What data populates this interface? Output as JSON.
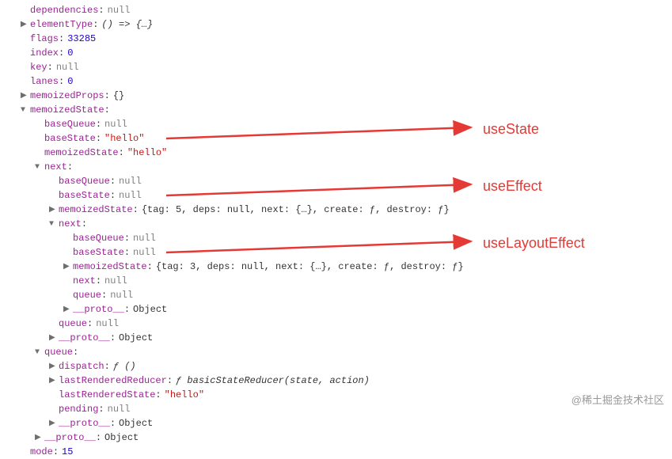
{
  "lines": {
    "dependencies": "dependencies",
    "elementType": "elementType",
    "flags": "flags",
    "index": "index",
    "keyProp": "key",
    "lanes": "lanes",
    "memoizedProps": "memoizedProps",
    "memoizedState": "memoizedState",
    "baseQueue": "baseQueue",
    "baseState": "baseState",
    "next": "next",
    "queue": "queue",
    "proto": "__proto__",
    "dispatch": "dispatch",
    "lastRenderedReducer": "lastRenderedReducer",
    "lastRenderedState": "lastRenderedState",
    "pending": "pending",
    "mode": "mode"
  },
  "values": {
    "null": "null",
    "arrowFn": "() => {…}",
    "flags": "33285",
    "index": "0",
    "lanes": "0",
    "emptyObj": "{}",
    "hello": "\"hello\"",
    "effectObj5": "{tag: 5, deps: null, next: {…}, create: ƒ, destroy: ƒ}",
    "effectObj3": "{tag: 3, deps: null, next: {…}, create: ƒ, destroy: ƒ}",
    "object": "Object",
    "fnEmpty": "ƒ ()",
    "reducerFn": "ƒ basicStateReducer(state, action)",
    "mode": "15"
  },
  "labels": {
    "useState": "useState",
    "useEffect": "useEffect",
    "useLayoutEffect": "useLayoutEffect"
  },
  "watermark": "@稀土掘金技术社区",
  "chart_data": {
    "type": "table",
    "title": "React Fiber node object (DevTools inspection)",
    "fiber": {
      "dependencies": null,
      "elementType": "() => {…}",
      "flags": 33285,
      "index": 0,
      "key": null,
      "lanes": 0,
      "memoizedProps": {},
      "memoizedState": {
        "baseQueue": null,
        "baseState": "hello",
        "memoizedState": "hello",
        "next": {
          "baseQueue": null,
          "baseState": null,
          "memoizedState": "{tag: 5, deps: null, next: {…}, create: ƒ, destroy: ƒ}",
          "next": {
            "baseQueue": null,
            "baseState": null,
            "memoizedState": "{tag: 3, deps: null, next: {…}, create: ƒ, destroy: ƒ}",
            "next": null,
            "queue": null,
            "__proto__": "Object"
          },
          "queue": null,
          "__proto__": "Object"
        },
        "queue": {
          "dispatch": "ƒ ()",
          "lastRenderedReducer": "ƒ basicStateReducer(state, action)",
          "lastRenderedState": "hello",
          "pending": null,
          "__proto__": "Object"
        },
        "__proto__": "Object"
      },
      "mode": 15
    },
    "annotations": [
      {
        "hook": "useState",
        "points_to": "memoizedState (baseState: 'hello')"
      },
      {
        "hook": "useEffect",
        "points_to": "memoizedState.next (tag: 5)"
      },
      {
        "hook": "useLayoutEffect",
        "points_to": "memoizedState.next.next (tag: 3)"
      }
    ]
  }
}
